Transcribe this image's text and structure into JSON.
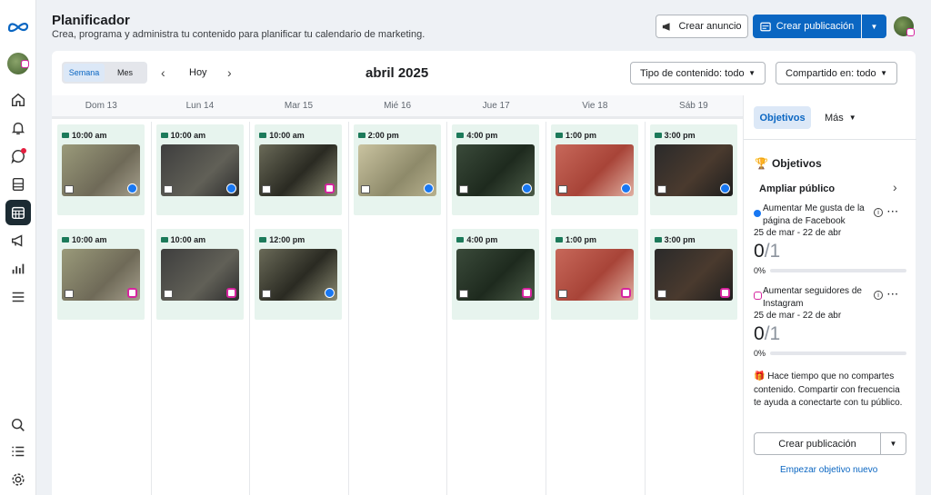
{
  "header": {
    "title": "Planificador",
    "subtitle": "Crea, programa y administra tu contenido para planificar tu calendario de marketing.",
    "create_ad": "Crear anuncio",
    "create_post": "Crear publicación"
  },
  "calendar": {
    "view_week": "Semana",
    "view_month": "Mes",
    "today": "Hoy",
    "month": "abril 2025",
    "filter_content": "Tipo de contenido: todo",
    "filter_shared": "Compartido en: todo",
    "days": [
      "Dom 13",
      "Lun 14",
      "Mar 15",
      "Mié 16",
      "Jue 17",
      "Vie 18",
      "Sáb 19"
    ],
    "posts": [
      {
        "day": 0,
        "row": 0,
        "time": "10:00 am",
        "network": "fb",
        "thumb": "t1"
      },
      {
        "day": 1,
        "row": 0,
        "time": "10:00 am",
        "network": "fb",
        "thumb": "t2"
      },
      {
        "day": 2,
        "row": 0,
        "time": "10:00 am",
        "network": "ig",
        "thumb": "t3"
      },
      {
        "day": 3,
        "row": 0,
        "time": "2:00 pm",
        "network": "fb",
        "thumb": "t4"
      },
      {
        "day": 4,
        "row": 0,
        "time": "4:00 pm",
        "network": "fb",
        "thumb": "t5"
      },
      {
        "day": 5,
        "row": 0,
        "time": "1:00 pm",
        "network": "fb",
        "thumb": "t6"
      },
      {
        "day": 6,
        "row": 0,
        "time": "3:00 pm",
        "network": "fb",
        "thumb": "t7"
      },
      {
        "day": 0,
        "row": 1,
        "time": "10:00 am",
        "network": "ig",
        "thumb": "t1"
      },
      {
        "day": 1,
        "row": 1,
        "time": "10:00 am",
        "network": "ig",
        "thumb": "t2"
      },
      {
        "day": 2,
        "row": 1,
        "time": "12:00 pm",
        "network": "fb",
        "thumb": "t3"
      },
      {
        "day": 4,
        "row": 1,
        "time": "4:00 pm",
        "network": "ig",
        "thumb": "t5"
      },
      {
        "day": 5,
        "row": 1,
        "time": "1:00 pm",
        "network": "ig",
        "thumb": "t6"
      },
      {
        "day": 6,
        "row": 1,
        "time": "3:00 pm",
        "network": "ig",
        "thumb": "t7"
      }
    ]
  },
  "panel": {
    "tab_goals": "Objetivos",
    "tab_more": "Más",
    "heading": "Objetivos",
    "section": "Ampliar público",
    "goal1": {
      "title": "Aumentar Me gusta de la página de Facebook",
      "range": "25 de mar - 22 de abr",
      "current": "0",
      "target": "/1",
      "percent": "0%",
      "progress": 0
    },
    "goal2": {
      "title": "Aumentar seguidores de Instagram",
      "range": "25 de mar - 22 de abr",
      "current": "0",
      "target": "/1",
      "percent": "0%",
      "progress": 0
    },
    "tip": "Hace tiempo que no compartes contenido. Compartir con frecuencia te ayuda a conectarte con tu público.",
    "create_post": "Crear publicación",
    "new_goal": "Empezar objetivo nuevo"
  },
  "colors": {
    "accent": "#0a66c2",
    "post_bg": "#e7f4ee",
    "facebook": "#1877f2",
    "instagram": "#d6249f"
  }
}
